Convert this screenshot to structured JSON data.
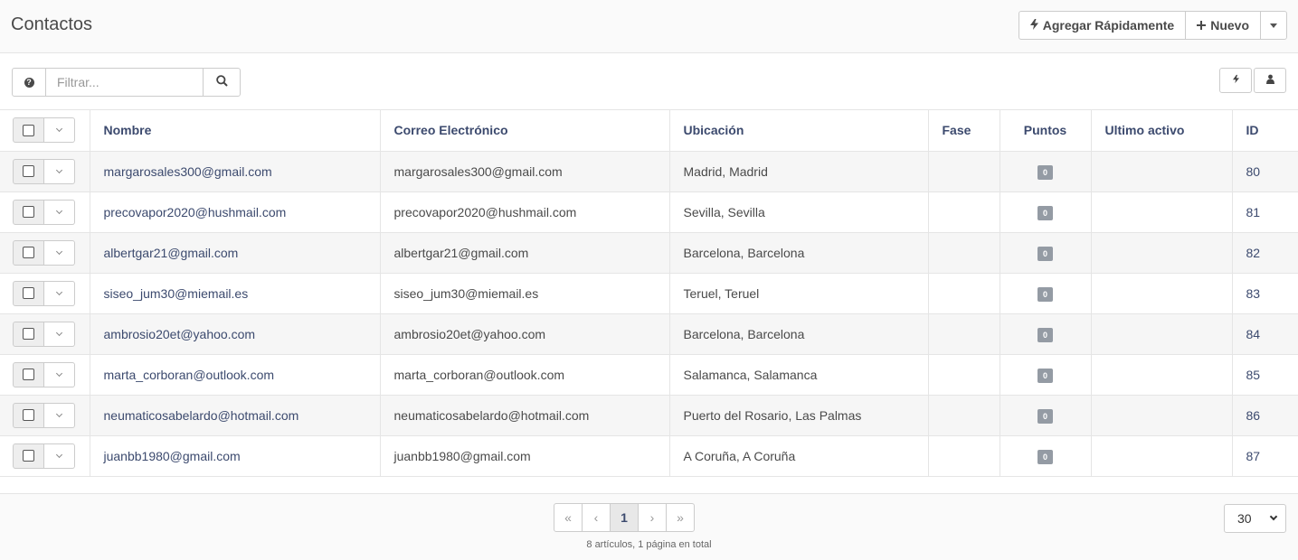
{
  "header": {
    "title": "Contactos",
    "quick_add_label": "Agregar Rápidamente",
    "new_label": "Nuevo"
  },
  "toolbar": {
    "filter_placeholder": "Filtrar..."
  },
  "table": {
    "columns": [
      "Nombre",
      "Correo Electrónico",
      "Ubicación",
      "Fase",
      "Puntos",
      "Ultimo activo",
      "ID"
    ],
    "rows": [
      {
        "name": "margarosales300@gmail.com",
        "email": "margarosales300@gmail.com",
        "location": "Madrid, Madrid",
        "stage": "",
        "points": "0",
        "last_active": "",
        "id": "80"
      },
      {
        "name": "precovapor2020@hushmail.com",
        "email": "precovapor2020@hushmail.com",
        "location": "Sevilla, Sevilla",
        "stage": "",
        "points": "0",
        "last_active": "",
        "id": "81"
      },
      {
        "name": "albertgar21@gmail.com",
        "email": "albertgar21@gmail.com",
        "location": "Barcelona, Barcelona",
        "stage": "",
        "points": "0",
        "last_active": "",
        "id": "82"
      },
      {
        "name": "siseo_jum30@miemail.es",
        "email": "siseo_jum30@miemail.es",
        "location": "Teruel, Teruel",
        "stage": "",
        "points": "0",
        "last_active": "",
        "id": "83"
      },
      {
        "name": "ambrosio20et@yahoo.com",
        "email": "ambrosio20et@yahoo.com",
        "location": "Barcelona, Barcelona",
        "stage": "",
        "points": "0",
        "last_active": "",
        "id": "84"
      },
      {
        "name": "marta_corboran@outlook.com",
        "email": "marta_corboran@outlook.com",
        "location": "Salamanca, Salamanca",
        "stage": "",
        "points": "0",
        "last_active": "",
        "id": "85"
      },
      {
        "name": "neumaticosabelardo@hotmail.com",
        "email": "neumaticosabelardo@hotmail.com",
        "location": "Puerto del Rosario, Las Palmas",
        "stage": "",
        "points": "0",
        "last_active": "",
        "id": "86"
      },
      {
        "name": "juanbb1980@gmail.com",
        "email": "juanbb1980@gmail.com",
        "location": "A Coruña, A Coruña",
        "stage": "",
        "points": "0",
        "last_active": "",
        "id": "87"
      }
    ]
  },
  "pagination": {
    "first": "«",
    "prev": "‹",
    "current": "1",
    "next": "›",
    "last": "»",
    "summary": "8 artículos, 1 página en total",
    "per_page": "30"
  },
  "icons": {
    "quick_add": "bolt-icon",
    "new": "plus-icon",
    "help": "question-circle-icon",
    "search": "search-icon",
    "lightning": "bolt-icon",
    "privacy": "user-secret-icon"
  }
}
